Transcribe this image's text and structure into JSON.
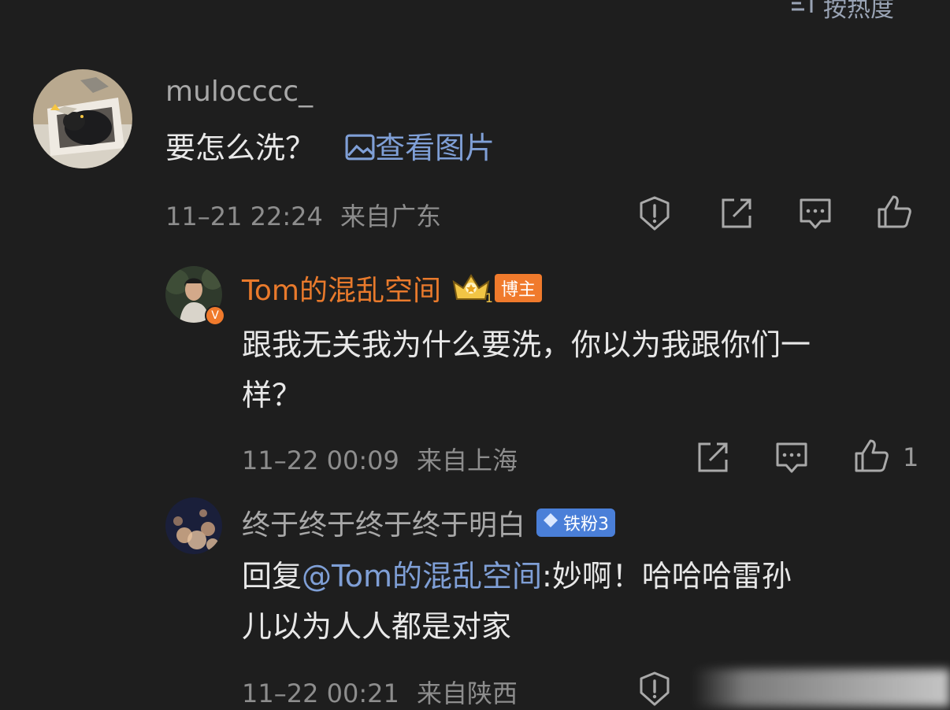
{
  "header": {
    "sort_label": "按热度",
    "sort_icon": "sort-hot-icon"
  },
  "comments": [
    {
      "username": "mulocccc_",
      "text": "要怎么洗？",
      "image_link": "查看图片",
      "time": "11–21 22:24",
      "location": "来自广东"
    }
  ],
  "replies": [
    {
      "username": "Tom的混乱空间",
      "badge": "博主",
      "crown_level": "1",
      "text_line1": "跟我无关我为什么要洗，你以为我跟你们一",
      "text_line2": "样？",
      "time": "11–22 00:09",
      "location": "来自上海",
      "likes": "1"
    },
    {
      "username": "终于终于终于终于明白",
      "badge": "铁粉3",
      "reply_prefix": "回复",
      "mention": "@Tom的混乱空间",
      "text_rest_line1": ":妙啊！哈哈哈雷孙",
      "text_line2": "儿以为人人都是对家",
      "time": "11–22 00:21",
      "location": "来自陕西"
    }
  ],
  "colors": {
    "background": "#1e1e1e",
    "owner_name": "#e97a2c",
    "link": "#7f9fd6",
    "fan_badge": "#4a7fd8"
  }
}
